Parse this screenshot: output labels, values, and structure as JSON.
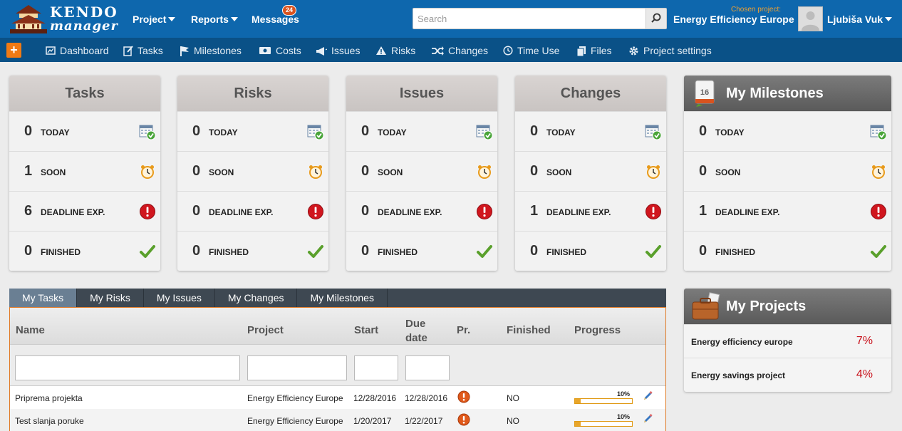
{
  "brand": {
    "line1": "KENDO",
    "line2": "manager"
  },
  "topnav": {
    "project": "Project",
    "reports": "Reports",
    "messages": "Messages",
    "messages_badge": "24"
  },
  "search": {
    "placeholder": "Search"
  },
  "chosen_project": {
    "label": "Chosen project:",
    "value": "Energy Efficiency Europe"
  },
  "user": {
    "name": "Ljubiša Vuk"
  },
  "subnav": {
    "add": "+",
    "items": [
      "Dashboard",
      "Tasks",
      "Milestones",
      "Costs",
      "Issues",
      "Risks",
      "Changes",
      "Time Use",
      "Files",
      "Project settings"
    ]
  },
  "row_labels": [
    "TODAY",
    "SOON",
    "DEADLINE EXP.",
    "FINISHED"
  ],
  "panels": [
    {
      "title": "Tasks",
      "counts": [
        "0",
        "1",
        "6",
        "0"
      ]
    },
    {
      "title": "Risks",
      "counts": [
        "0",
        "0",
        "0",
        "0"
      ]
    },
    {
      "title": "Issues",
      "counts": [
        "0",
        "0",
        "0",
        "0"
      ]
    },
    {
      "title": "Changes",
      "counts": [
        "0",
        "0",
        "1",
        "0"
      ]
    },
    {
      "title": "My Milestones",
      "calendar_day": "16",
      "counts": [
        "0",
        "0",
        "1",
        "0"
      ]
    }
  ],
  "tabs": [
    "My Tasks",
    "My Risks",
    "My Issues",
    "My Changes",
    "My Milestones"
  ],
  "table": {
    "columns": [
      "Name",
      "Project",
      "Start",
      "Due date",
      "Pr.",
      "Finished",
      "Progress"
    ],
    "rows": [
      {
        "name": "Priprema projekta",
        "project": "Energy Efficiency Europe",
        "start": "12/28/2016",
        "due": "12/28/2016",
        "finished": "NO",
        "progress": "10%",
        "progress_value": 0.1
      },
      {
        "name": "Test slanja poruke",
        "project": "Energy Efficiency Europe",
        "start": "1/20/2017",
        "due": "1/22/2017",
        "finished": "NO",
        "progress": "10%",
        "progress_value": 0.1
      }
    ]
  },
  "my_projects": {
    "title": "My Projects",
    "items": [
      {
        "name": "Energy efficiency europe",
        "percent": "7%"
      },
      {
        "name": "Energy savings project",
        "percent": "4%"
      }
    ]
  },
  "colors": {
    "topbar": "#0e67ad",
    "subbar": "#0a5187",
    "accent_orange": "#f07a14",
    "percent_red": "#c8101a",
    "check_green": "#5aa02c",
    "alert_red": "#d0161e"
  },
  "icons": {
    "today": "calendar-check-icon",
    "soon": "alarm-clock-icon",
    "deadline": "exclamation-circle-icon",
    "finished": "checkmark-icon"
  }
}
